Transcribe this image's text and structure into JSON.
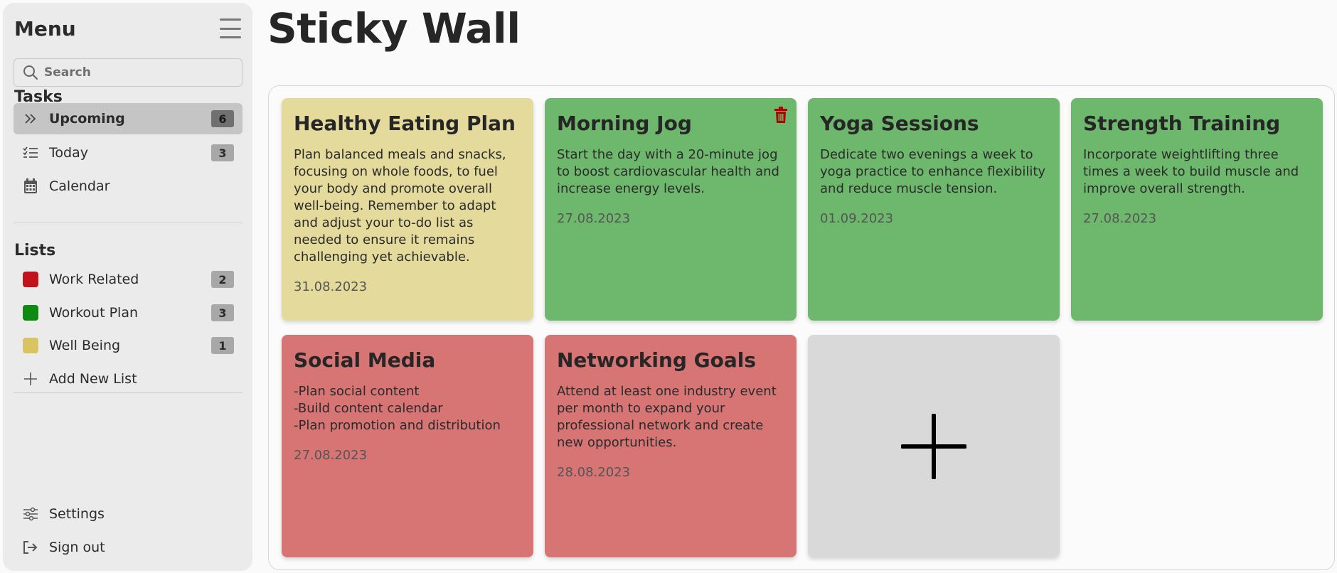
{
  "sidebar": {
    "title": "Menu",
    "search_placeholder": "Search",
    "tasks_heading": "Tasks",
    "tasks": [
      {
        "label": "Upcoming",
        "count": "6",
        "icon": "double-chevron-right-icon",
        "active": true
      },
      {
        "label": "Today",
        "count": "3",
        "icon": "checklist-icon"
      },
      {
        "label": "Calendar",
        "icon": "calendar-icon"
      }
    ],
    "lists_heading": "Lists",
    "lists": [
      {
        "label": "Work Related",
        "count": "2",
        "color": "#c0141a"
      },
      {
        "label": "Workout Plan",
        "count": "3",
        "color": "#0e8a12"
      },
      {
        "label": "Well Being",
        "count": "1",
        "color": "#d9c460"
      }
    ],
    "add_list_label": "Add New List",
    "settings_label": "Settings",
    "signout_label": "Sign out"
  },
  "main": {
    "title": "Sticky Wall",
    "notes": [
      {
        "title": "Healthy Eating Plan",
        "body": "Plan balanced meals and snacks, focusing on whole foods, to fuel your body and promote overall well-being. Remember to adapt and adjust your to-do list as needed to ensure it remains challenging yet achievable.",
        "date": "31.08.2023",
        "color": "#e4da9c"
      },
      {
        "title": "Morning Jog",
        "body": "Start the day with a 20-minute jog to boost cardiovascular health and increase energy levels.",
        "date": "27.08.2023",
        "color": "#6db86d",
        "has_delete": true
      },
      {
        "title": "Yoga Sessions",
        "body": "Dedicate two evenings a week to yoga practice to enhance flexibility and reduce muscle tension.",
        "date": "01.09.2023",
        "color": "#6db86d"
      },
      {
        "title": "Strength Training",
        "body": "Incorporate weightlifting three times a week to build muscle and improve overall strength.",
        "date": "27.08.2023",
        "color": "#6db86d"
      },
      {
        "title": "Social Media",
        "body": "-Plan social content\n-Build content calendar\n-Plan promotion and distribution",
        "date": "27.08.2023",
        "color": "#d77474"
      },
      {
        "title": "Networking Goals",
        "body": "Attend at least one industry event per month to expand your professional network and create new opportunities.",
        "date": "28.08.2023",
        "color": "#d77474"
      }
    ]
  }
}
